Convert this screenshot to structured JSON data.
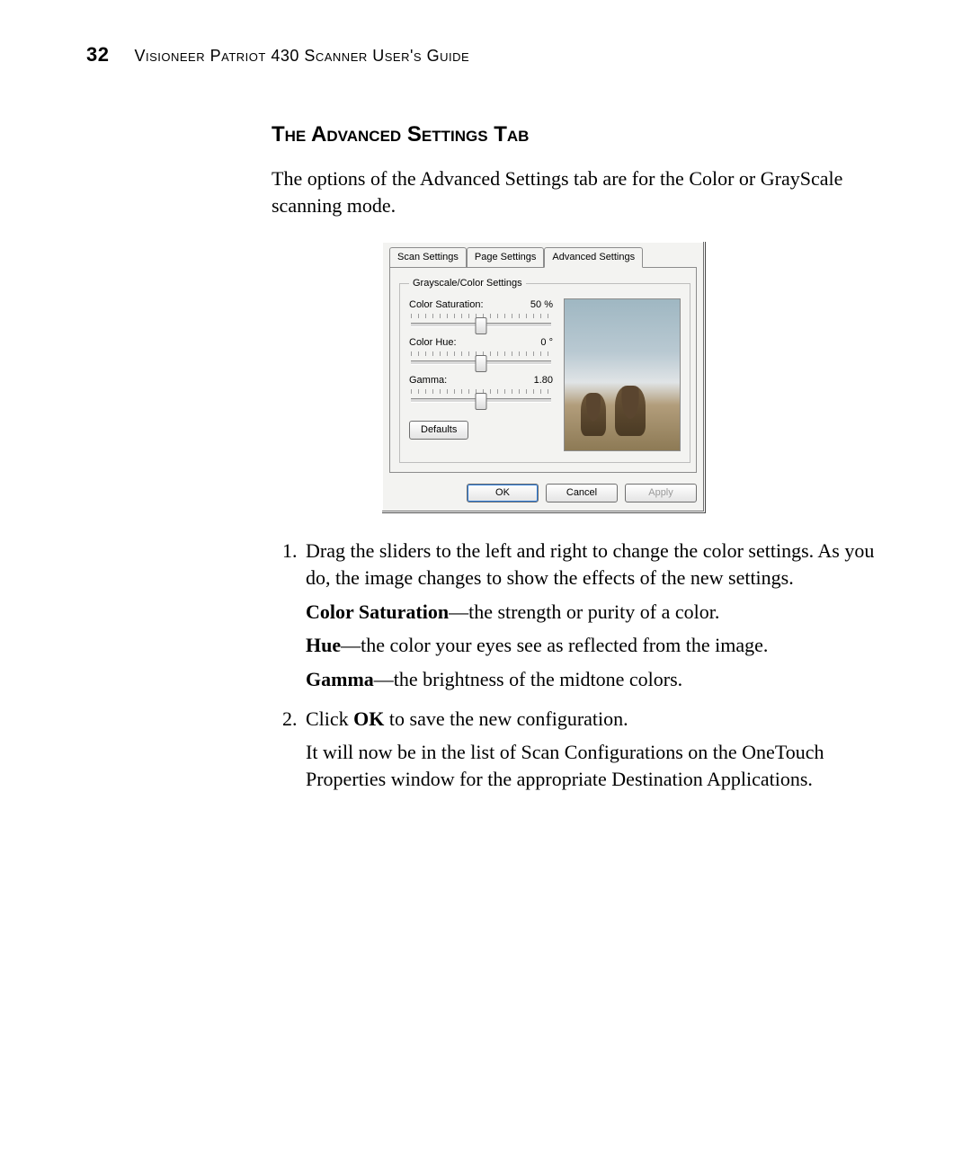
{
  "page_number": "32",
  "running_title": "Visioneer Patriot 430 Scanner User's Guide",
  "section_heading": "The Advanced Settings Tab",
  "lead_paragraph": "The options of the Advanced Settings tab are for the Color or GrayScale scanning mode.",
  "dialog": {
    "tabs": {
      "scan": "Scan Settings",
      "page": "Page Settings",
      "advanced": "Advanced Settings"
    },
    "group_legend": "Grayscale/Color Settings",
    "sliders": {
      "saturation": {
        "label": "Color Saturation:",
        "value": "50 %"
      },
      "hue": {
        "label": "Color Hue:",
        "value": "0 °"
      },
      "gamma": {
        "label": "Gamma:",
        "value": "1.80"
      }
    },
    "defaults_button": "Defaults",
    "buttons": {
      "ok": "OK",
      "cancel": "Cancel",
      "apply": "Apply"
    }
  },
  "steps": {
    "s1_text": "Drag the sliders to the left and right to change the color settings. As you do, the image changes to show the effects of the new settings.",
    "sat_term": "Color Saturation",
    "sat_desc": "—the strength or purity of a color.",
    "hue_term": "Hue",
    "hue_desc": "—the color your eyes see as reflected from the image.",
    "gam_term": "Gamma",
    "gam_desc": "—the brightness of the midtone colors.",
    "s2_pre": "Click ",
    "s2_ok": "OK",
    "s2_post": " to save the new configuration.",
    "s2_p2": "It will now be in the list of Scan Configurations on the OneTouch Properties window for the appropriate Destination Applications."
  }
}
